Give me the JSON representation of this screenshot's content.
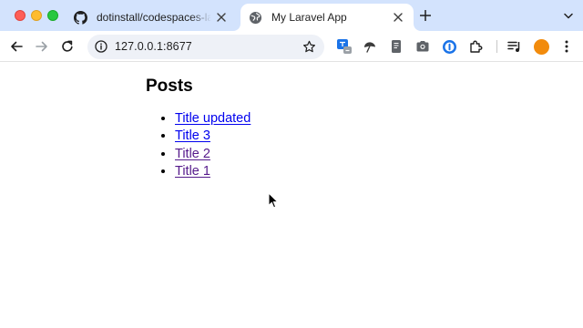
{
  "window": {
    "tabs": [
      {
        "title": "dotinstall/codespaces-laravel",
        "favicon": "github-icon",
        "active": false
      },
      {
        "title": "My Laravel App",
        "favicon": "globe-icon",
        "active": true
      }
    ]
  },
  "toolbar": {
    "url": "127.0.0.1:8677"
  },
  "page": {
    "heading": "Posts",
    "posts": [
      {
        "title": "Title updated",
        "visited": false
      },
      {
        "title": "Title 3",
        "visited": false
      },
      {
        "title": "Title 2",
        "visited": true
      },
      {
        "title": "Title 1",
        "visited": true
      }
    ]
  },
  "colors": {
    "tabstrip": "#d3e3fd",
    "link": "#0000ee",
    "visited_link": "#551a8b",
    "avatar": "#f28b0c"
  }
}
